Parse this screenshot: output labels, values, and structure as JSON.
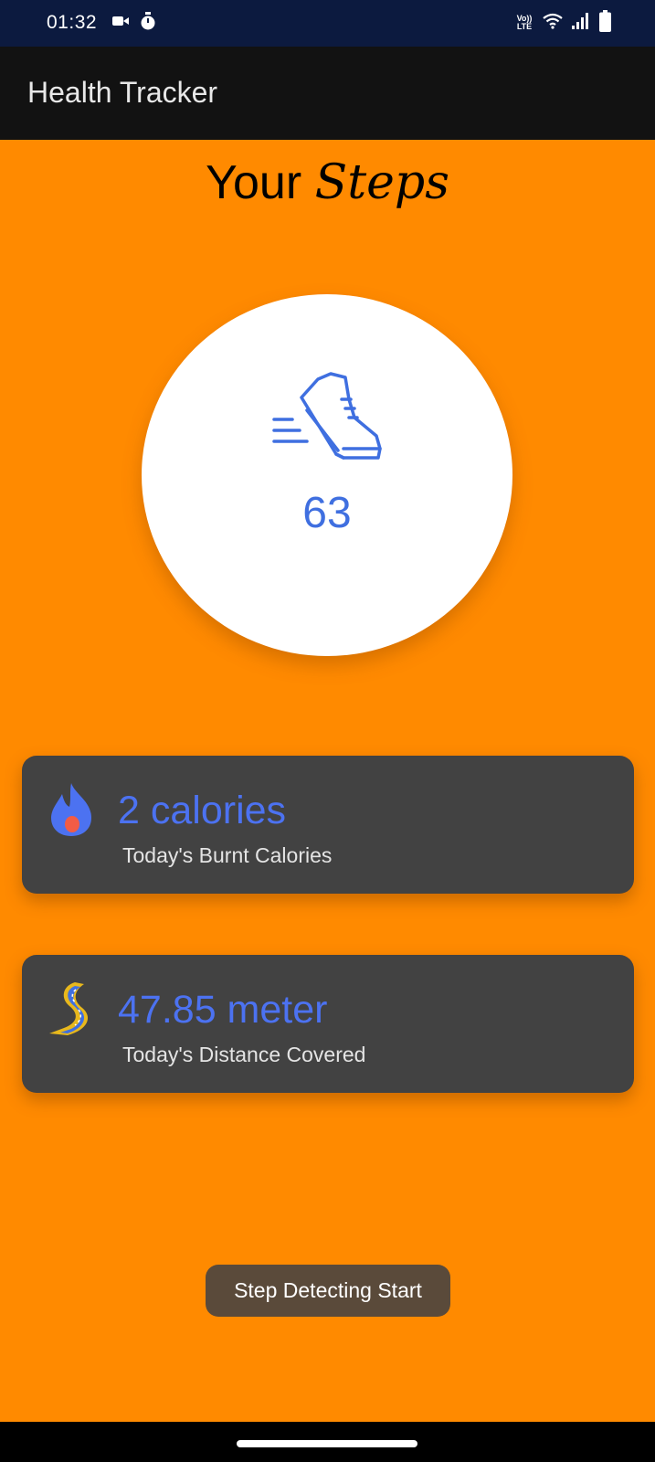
{
  "status_bar": {
    "time": "01:32",
    "volte_top": "Vo))",
    "volte_bottom": "LTE",
    "icons": [
      "video-camera-icon",
      "timer-icon",
      "volte-icon",
      "wifi-icon",
      "signal-icon",
      "battery-icon"
    ]
  },
  "app_bar": {
    "title": "Health Tracker"
  },
  "heading": {
    "your": "Your",
    "steps": "Steps"
  },
  "steps": {
    "count": "63",
    "icon": "walking-shoe-icon"
  },
  "calories_card": {
    "value": "2 calories",
    "label": "Today's Burnt Calories",
    "icon": "flame-icon"
  },
  "distance_card": {
    "value": "47.85 meter",
    "label": "Today's Distance Covered",
    "icon": "winding-road-icon"
  },
  "toast": {
    "message": "Step Detecting Start"
  },
  "colors": {
    "background": "#FF8A00",
    "status_bar": "#0C1A3F",
    "app_bar": "#121212",
    "accent_blue": "#4C72F1",
    "card": "#424242"
  }
}
